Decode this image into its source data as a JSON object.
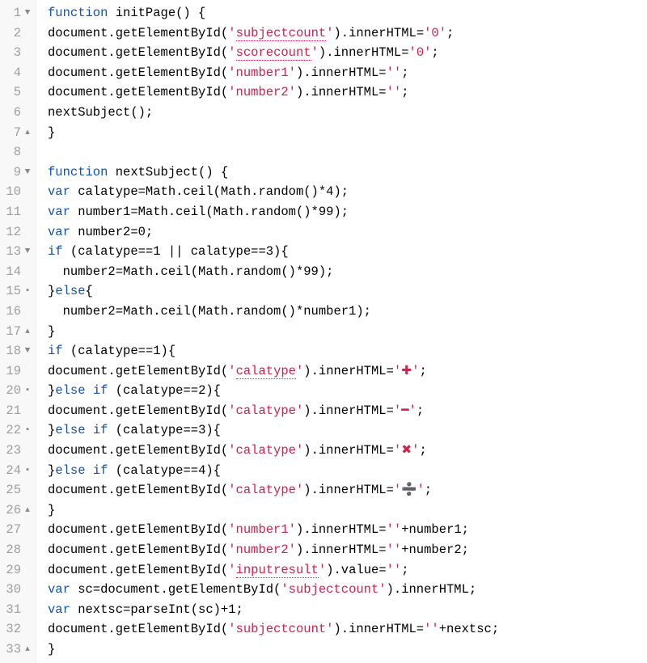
{
  "editor": {
    "language": "javascript",
    "lines": [
      {
        "num": 1,
        "fold": "▼",
        "indent": 0,
        "tokens": [
          [
            "kw",
            "function"
          ],
          [
            "plain",
            " initPage() {"
          ]
        ]
      },
      {
        "num": 2,
        "fold": "",
        "indent": 0,
        "tokens": [
          [
            "plain",
            "document.getElementById("
          ],
          [
            "str",
            "'"
          ],
          [
            "str_u",
            "subjectcount"
          ],
          [
            "str",
            "'"
          ],
          [
            "plain",
            ").innerHTML="
          ],
          [
            "str",
            "'0'"
          ],
          [
            "plain",
            ";"
          ]
        ]
      },
      {
        "num": 3,
        "fold": "",
        "indent": 0,
        "tokens": [
          [
            "plain",
            "document.getElementById("
          ],
          [
            "str",
            "'"
          ],
          [
            "str_u",
            "scorecount"
          ],
          [
            "str",
            "'"
          ],
          [
            "plain",
            ").innerHTML="
          ],
          [
            "str",
            "'0'"
          ],
          [
            "plain",
            ";"
          ]
        ]
      },
      {
        "num": 4,
        "fold": "",
        "indent": 0,
        "tokens": [
          [
            "plain",
            "document.getElementById("
          ],
          [
            "str",
            "'number1'"
          ],
          [
            "plain",
            ").innerHTML="
          ],
          [
            "str",
            "''"
          ],
          [
            "plain",
            ";"
          ]
        ]
      },
      {
        "num": 5,
        "fold": "",
        "indent": 0,
        "tokens": [
          [
            "plain",
            "document.getElementById("
          ],
          [
            "str",
            "'number2'"
          ],
          [
            "plain",
            ").innerHTML="
          ],
          [
            "str",
            "''"
          ],
          [
            "plain",
            ";"
          ]
        ]
      },
      {
        "num": 6,
        "fold": "",
        "indent": 0,
        "tokens": [
          [
            "plain",
            "nextSubject();"
          ]
        ]
      },
      {
        "num": 7,
        "fold": "▴",
        "indent": 0,
        "tokens": [
          [
            "plain",
            "}"
          ]
        ]
      },
      {
        "num": 8,
        "fold": "",
        "indent": 0,
        "tokens": [
          [
            "plain",
            ""
          ]
        ]
      },
      {
        "num": 9,
        "fold": "▼",
        "indent": 0,
        "tokens": [
          [
            "kw",
            "function"
          ],
          [
            "plain",
            " nextSubject() {"
          ]
        ]
      },
      {
        "num": 10,
        "fold": "",
        "indent": 0,
        "tokens": [
          [
            "kw",
            "var"
          ],
          [
            "plain",
            " calatype=Math.ceil(Math.random()*4);"
          ]
        ]
      },
      {
        "num": 11,
        "fold": "",
        "indent": 0,
        "tokens": [
          [
            "kw",
            "var"
          ],
          [
            "plain",
            " number1=Math.ceil(Math.random()*99);"
          ]
        ]
      },
      {
        "num": 12,
        "fold": "",
        "indent": 0,
        "tokens": [
          [
            "kw",
            "var"
          ],
          [
            "plain",
            " number2=0;"
          ]
        ]
      },
      {
        "num": 13,
        "fold": "▼",
        "indent": 0,
        "tokens": [
          [
            "kw",
            "if"
          ],
          [
            "plain",
            " (calatype==1 || calatype==3){"
          ]
        ]
      },
      {
        "num": 14,
        "fold": "",
        "indent": 1,
        "tokens": [
          [
            "plain",
            "number2=Math.ceil(Math.random()*99);"
          ]
        ]
      },
      {
        "num": 15,
        "fold": "▪",
        "indent": 0,
        "tokens": [
          [
            "plain",
            "}"
          ],
          [
            "kw",
            "else"
          ],
          [
            "plain",
            "{"
          ]
        ]
      },
      {
        "num": 16,
        "fold": "",
        "indent": 1,
        "tokens": [
          [
            "plain",
            "number2=Math.ceil(Math.random()*number1);"
          ]
        ]
      },
      {
        "num": 17,
        "fold": "▴",
        "indent": 0,
        "tokens": [
          [
            "plain",
            "}"
          ]
        ]
      },
      {
        "num": 18,
        "fold": "▼",
        "indent": 0,
        "tokens": [
          [
            "kw",
            "if"
          ],
          [
            "plain",
            " (calatype==1){"
          ]
        ]
      },
      {
        "num": 19,
        "fold": "",
        "indent": 0,
        "tokens": [
          [
            "plain",
            "document.getElementById("
          ],
          [
            "str",
            "'"
          ],
          [
            "str_u",
            "calatype"
          ],
          [
            "str",
            "'"
          ],
          [
            "plain",
            ").innerHTML="
          ],
          [
            "str",
            "'✚'"
          ],
          [
            "plain",
            ";"
          ]
        ]
      },
      {
        "num": 20,
        "fold": "▪",
        "indent": 0,
        "tokens": [
          [
            "plain",
            "}"
          ],
          [
            "kw",
            "else"
          ],
          [
            "plain",
            " "
          ],
          [
            "kw",
            "if"
          ],
          [
            "plain",
            " (calatype==2){"
          ]
        ]
      },
      {
        "num": 21,
        "fold": "",
        "indent": 0,
        "tokens": [
          [
            "plain",
            "document.getElementById("
          ],
          [
            "str",
            "'calatype'"
          ],
          [
            "plain",
            ").innerHTML="
          ],
          [
            "str",
            "'━'"
          ],
          [
            "plain",
            ";"
          ]
        ]
      },
      {
        "num": 22,
        "fold": "▪",
        "indent": 0,
        "tokens": [
          [
            "plain",
            "}"
          ],
          [
            "kw",
            "else"
          ],
          [
            "plain",
            " "
          ],
          [
            "kw",
            "if"
          ],
          [
            "plain",
            " (calatype==3){"
          ]
        ]
      },
      {
        "num": 23,
        "fold": "",
        "indent": 0,
        "tokens": [
          [
            "plain",
            "document.getElementById("
          ],
          [
            "str",
            "'calatype'"
          ],
          [
            "plain",
            ").innerHTML="
          ],
          [
            "str",
            "'✖'"
          ],
          [
            "plain",
            ";"
          ]
        ]
      },
      {
        "num": 24,
        "fold": "▪",
        "indent": 0,
        "tokens": [
          [
            "plain",
            "}"
          ],
          [
            "kw",
            "else"
          ],
          [
            "plain",
            " "
          ],
          [
            "kw",
            "if"
          ],
          [
            "plain",
            " (calatype==4){"
          ]
        ]
      },
      {
        "num": 25,
        "fold": "",
        "indent": 0,
        "tokens": [
          [
            "plain",
            "document.getElementById("
          ],
          [
            "str",
            "'calatype'"
          ],
          [
            "plain",
            ").innerHTML="
          ],
          [
            "str",
            "'➗'"
          ],
          [
            "plain",
            ";"
          ]
        ]
      },
      {
        "num": 26,
        "fold": "▴",
        "indent": 0,
        "tokens": [
          [
            "plain",
            "}"
          ]
        ]
      },
      {
        "num": 27,
        "fold": "",
        "indent": 0,
        "tokens": [
          [
            "plain",
            "document.getElementById("
          ],
          [
            "str",
            "'number1'"
          ],
          [
            "plain",
            ").innerHTML="
          ],
          [
            "str",
            "''"
          ],
          [
            "plain",
            "+number1;"
          ]
        ]
      },
      {
        "num": 28,
        "fold": "",
        "indent": 0,
        "tokens": [
          [
            "plain",
            "document.getElementById("
          ],
          [
            "str",
            "'number2'"
          ],
          [
            "plain",
            ").innerHTML="
          ],
          [
            "str",
            "''"
          ],
          [
            "plain",
            "+number2;"
          ]
        ]
      },
      {
        "num": 29,
        "fold": "",
        "indent": 0,
        "tokens": [
          [
            "plain",
            "document.getElementById("
          ],
          [
            "str",
            "'"
          ],
          [
            "str_u",
            "inputresult"
          ],
          [
            "str",
            "'"
          ],
          [
            "plain",
            ").value="
          ],
          [
            "str",
            "''"
          ],
          [
            "plain",
            ";"
          ]
        ]
      },
      {
        "num": 30,
        "fold": "",
        "indent": 0,
        "tokens": [
          [
            "kw",
            "var"
          ],
          [
            "plain",
            " sc=document.getElementById("
          ],
          [
            "str",
            "'subjectcount'"
          ],
          [
            "plain",
            ").innerHTML;"
          ]
        ]
      },
      {
        "num": 31,
        "fold": "",
        "indent": 0,
        "tokens": [
          [
            "kw",
            "var"
          ],
          [
            "plain",
            " nextsc=parseInt(sc)+1;"
          ]
        ]
      },
      {
        "num": 32,
        "fold": "",
        "indent": 0,
        "tokens": [
          [
            "plain",
            "document.getElementById("
          ],
          [
            "str",
            "'subjectcount'"
          ],
          [
            "plain",
            ").innerHTML="
          ],
          [
            "str",
            "''"
          ],
          [
            "plain",
            "+nextsc;"
          ]
        ]
      },
      {
        "num": 33,
        "fold": "▴",
        "indent": 0,
        "tokens": [
          [
            "plain",
            "}"
          ]
        ]
      }
    ]
  }
}
